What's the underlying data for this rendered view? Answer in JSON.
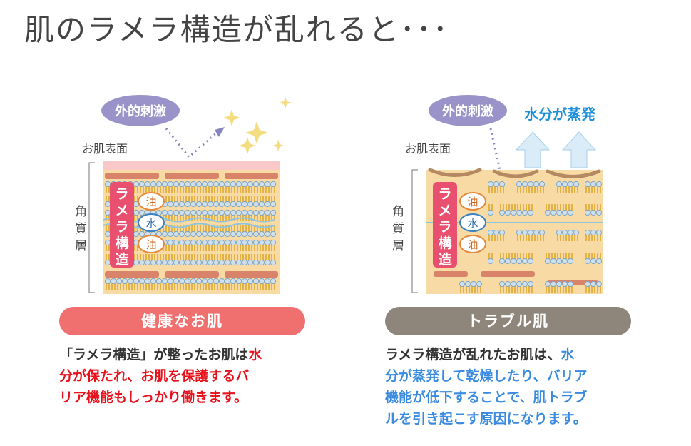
{
  "title": "肌のラメラ構造が乱れると･･･",
  "colors": {
    "skin": "#f8dba4",
    "surface_pink": "#f9c8c8",
    "lipid_bar": "#d9846a",
    "head": "#cfe0ec",
    "head_stroke": "#7fa7c6",
    "tail": "#e0a72a",
    "water": "#a8cfe4",
    "label_pink": "#e9506f",
    "oil_orange": "#e58a3d",
    "water_blue": "#3b82c4",
    "stimulus_purple": "#9a93c9",
    "healthy_pill": "#f07070",
    "trouble_pill": "#8e857b",
    "healthy_text": "#e8121c",
    "trouble_text": "#3a8be0",
    "evap_text": "#1f90d8"
  },
  "healthy": {
    "stimulus_label": "外的刺激",
    "surface_label": "お肌表面",
    "layer_label": [
      "角",
      "質",
      "層"
    ],
    "lamellar_label": [
      "ラ",
      "メ",
      "ラ",
      "構",
      "造"
    ],
    "oil_label": "油",
    "water_label": "水",
    "pill_label": "健康なお肌",
    "desc_lines": [
      {
        "plain": "「ラメラ構造」が整ったお肌は",
        "hl": "水"
      },
      {
        "plain": "",
        "hl": "分が保たれ、お肌を保護するバ"
      },
      {
        "plain": "",
        "hl": "リア機能もしっかり働きます。"
      }
    ]
  },
  "trouble": {
    "stimulus_label": "外的刺激",
    "evaporation_label": "水分が蒸発",
    "surface_label": "お肌表面",
    "layer_label": [
      "角",
      "質",
      "層"
    ],
    "lamellar_label": [
      "ラ",
      "メ",
      "ラ",
      "構",
      "造"
    ],
    "oil_label": "油",
    "water_label": "水",
    "pill_label": "トラブル肌",
    "desc_lines": [
      {
        "plain": "ラメラ構造が乱れたお肌は、",
        "hl": "水"
      },
      {
        "plain": "",
        "hl": "分が蒸発して乾燥したり、バリア"
      },
      {
        "plain": "",
        "hl": "機能が低下することで、肌トラブ"
      },
      {
        "plain": "",
        "hl": "ルを引き起こす原因になります。"
      }
    ]
  }
}
